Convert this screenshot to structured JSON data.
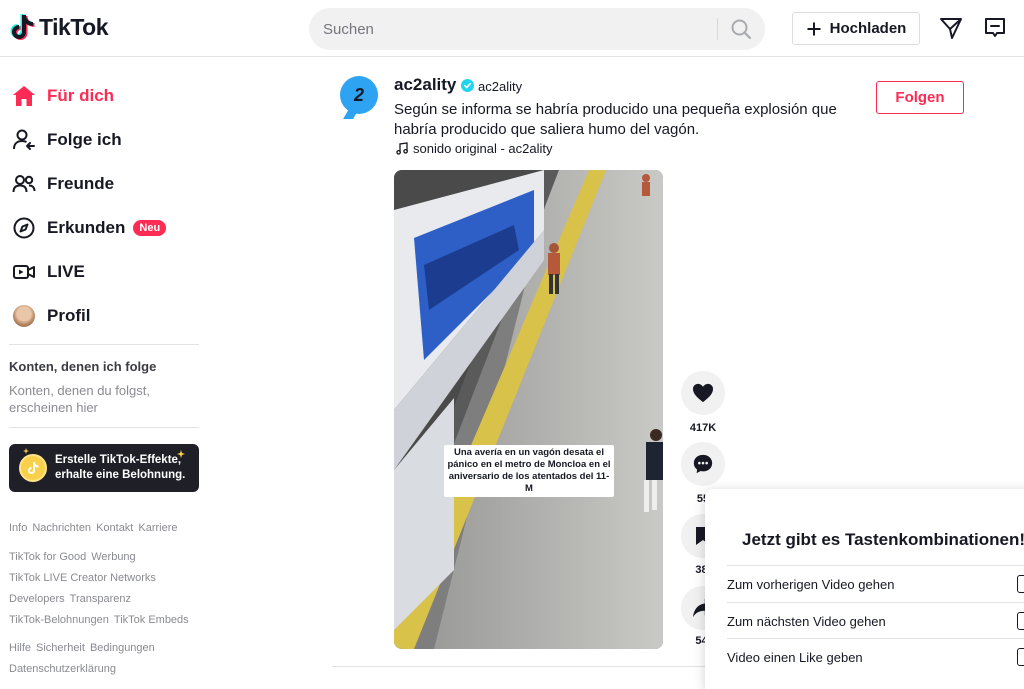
{
  "header": {
    "logo_text": "TikTok",
    "search_placeholder": "Suchen",
    "upload_label": "Hochladen"
  },
  "sidebar": {
    "nav": [
      {
        "label": "Für dich",
        "icon": "home-icon",
        "active": true
      },
      {
        "label": "Folge ich",
        "icon": "following-icon"
      },
      {
        "label": "Freunde",
        "icon": "friends-icon"
      },
      {
        "label": "Erkunden",
        "icon": "compass-icon",
        "badge": "Neu"
      },
      {
        "label": "LIVE",
        "icon": "live-icon"
      },
      {
        "label": "Profil",
        "icon": "avatar"
      }
    ],
    "following_heading": "Konten, denen ich folge",
    "following_empty": "Konten, denen du folgst, erscheinen hier",
    "promo_text_1": "Erstelle TikTok-Effekte,",
    "promo_text_2": "erhalte eine Belohnung.",
    "footer": [
      [
        "Info",
        "Nachrichten",
        "Kontakt",
        "Karriere"
      ],
      [
        "TikTok for Good",
        "Werbung"
      ],
      [
        "TikTok LIVE Creator Networks"
      ],
      [
        "Developers",
        "Transparenz"
      ],
      [
        "TikTok-Belohnungen",
        "TikTok Embeds"
      ],
      [
        "Hilfe",
        "Sicherheit",
        "Bedingungen"
      ],
      [
        "Datenschutzerklärung"
      ]
    ]
  },
  "post": {
    "author_name": "ac2ality",
    "author_handle": "ac2ality",
    "avatar_text": "2",
    "caption": "Según se informa se habría producido una pequeña explosión que habría producido que saliera humo del vagón.",
    "sound": "sonido original - ac2ality",
    "follow_label": "Folgen",
    "video_overlay": "Una avería en un vagón desata el pánico en el metro de Moncloa en el aniversario de los atentados del 11-M",
    "likes": "417K",
    "comments": "55",
    "saves": "38.",
    "shares": "54."
  },
  "shortcuts": {
    "title": "Jetzt gibt es Tastenkombinationen!",
    "items": [
      "Zum vorherigen Video gehen",
      "Zum nächsten Video gehen",
      "Video einen Like geben"
    ]
  },
  "colors": {
    "brand": "#fe2c55",
    "text": "#161823",
    "verified": "#20d5ec"
  }
}
